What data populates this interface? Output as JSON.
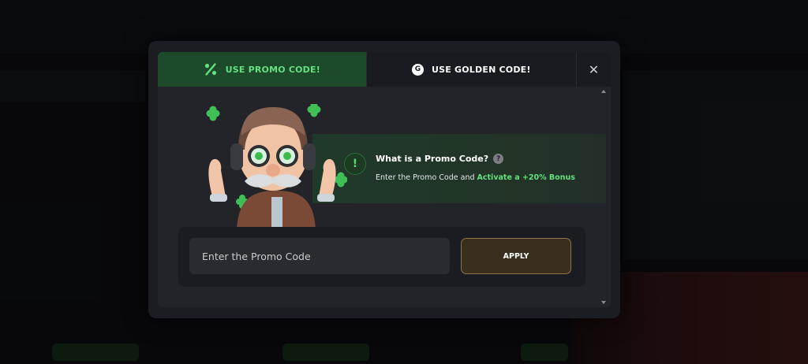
{
  "tabs": {
    "promo_label": "USE PROMO CODE!",
    "golden_label": "USE GOLDEN CODE!",
    "golden_badge": "G",
    "close_glyph": "✕"
  },
  "info": {
    "icon_glyph": "!",
    "title": "What is a Promo Code?",
    "help_glyph": "?",
    "description_prefix": "Enter the Promo Code and ",
    "description_highlight": "Activate a +20% Bonus"
  },
  "form": {
    "placeholder": "Enter the Promo Code",
    "value": "",
    "apply_label": "APPLY"
  },
  "colors": {
    "accent_green": "#63e07f",
    "active_tab_bg": "#1d4a2b",
    "apply_border": "#8d7246"
  },
  "icons": [
    "percent-icon",
    "golden-g-icon",
    "close-icon",
    "exclamation-icon",
    "question-icon",
    "scroll-up-icon",
    "scroll-down-icon"
  ]
}
